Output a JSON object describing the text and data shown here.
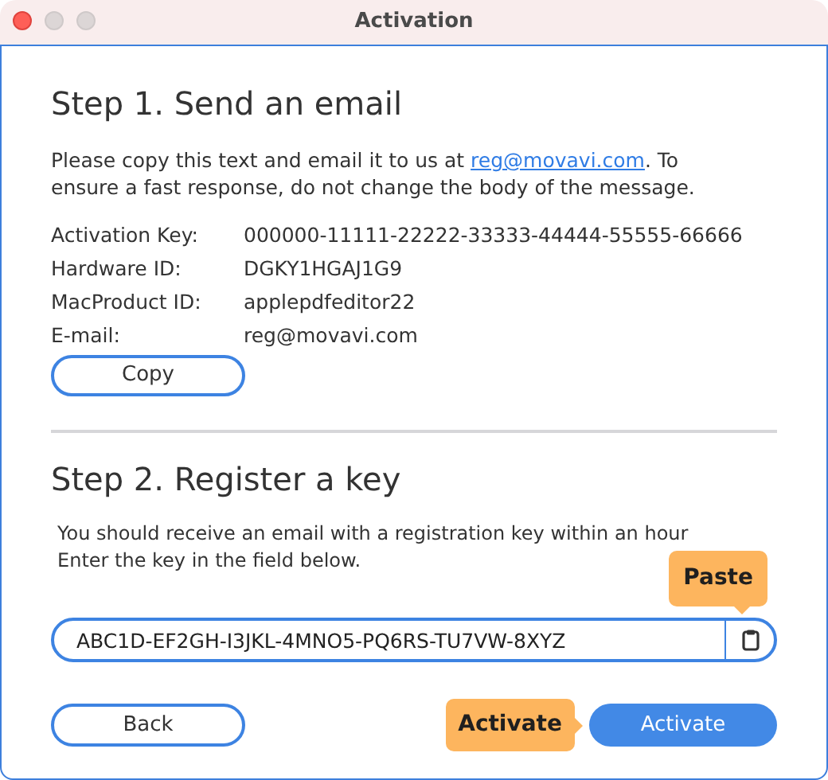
{
  "window": {
    "title": "Activation"
  },
  "step1": {
    "heading": "Step 1. Send an email",
    "instructions": {
      "before": "Please copy this text and email it to us at ",
      "link": "reg@movavi.com",
      "after": ". To ensure a fast response, do not change the body of the message."
    },
    "fields": [
      {
        "label": "Activation Key:",
        "value": "000000-11111-22222-33333-44444-55555-66666"
      },
      {
        "label": "Hardware ID:",
        "value": "DGKY1HGAJ1G9"
      },
      {
        "label": "MacProduct ID:",
        "value": "applepdfeditor22"
      },
      {
        "label": "E-mail:",
        "value": "reg@movavi.com"
      }
    ],
    "copy_button": "Copy"
  },
  "step2": {
    "heading": "Step 2. Register a key",
    "instructions": [
      "You should receive an email with a registration key within an hour",
      "Enter the key in the field below."
    ],
    "key_field": {
      "value": "ABC1D-EF2GH-I3JKL-4MNO5-PQ6RS-TU7VW-8XYZ"
    },
    "paste_callout": "Paste"
  },
  "buttons": [
    {
      "label": "Back",
      "kind": "secondary"
    },
    {
      "label": "Activate",
      "kind": "primary",
      "callout": "Activate"
    }
  ]
}
